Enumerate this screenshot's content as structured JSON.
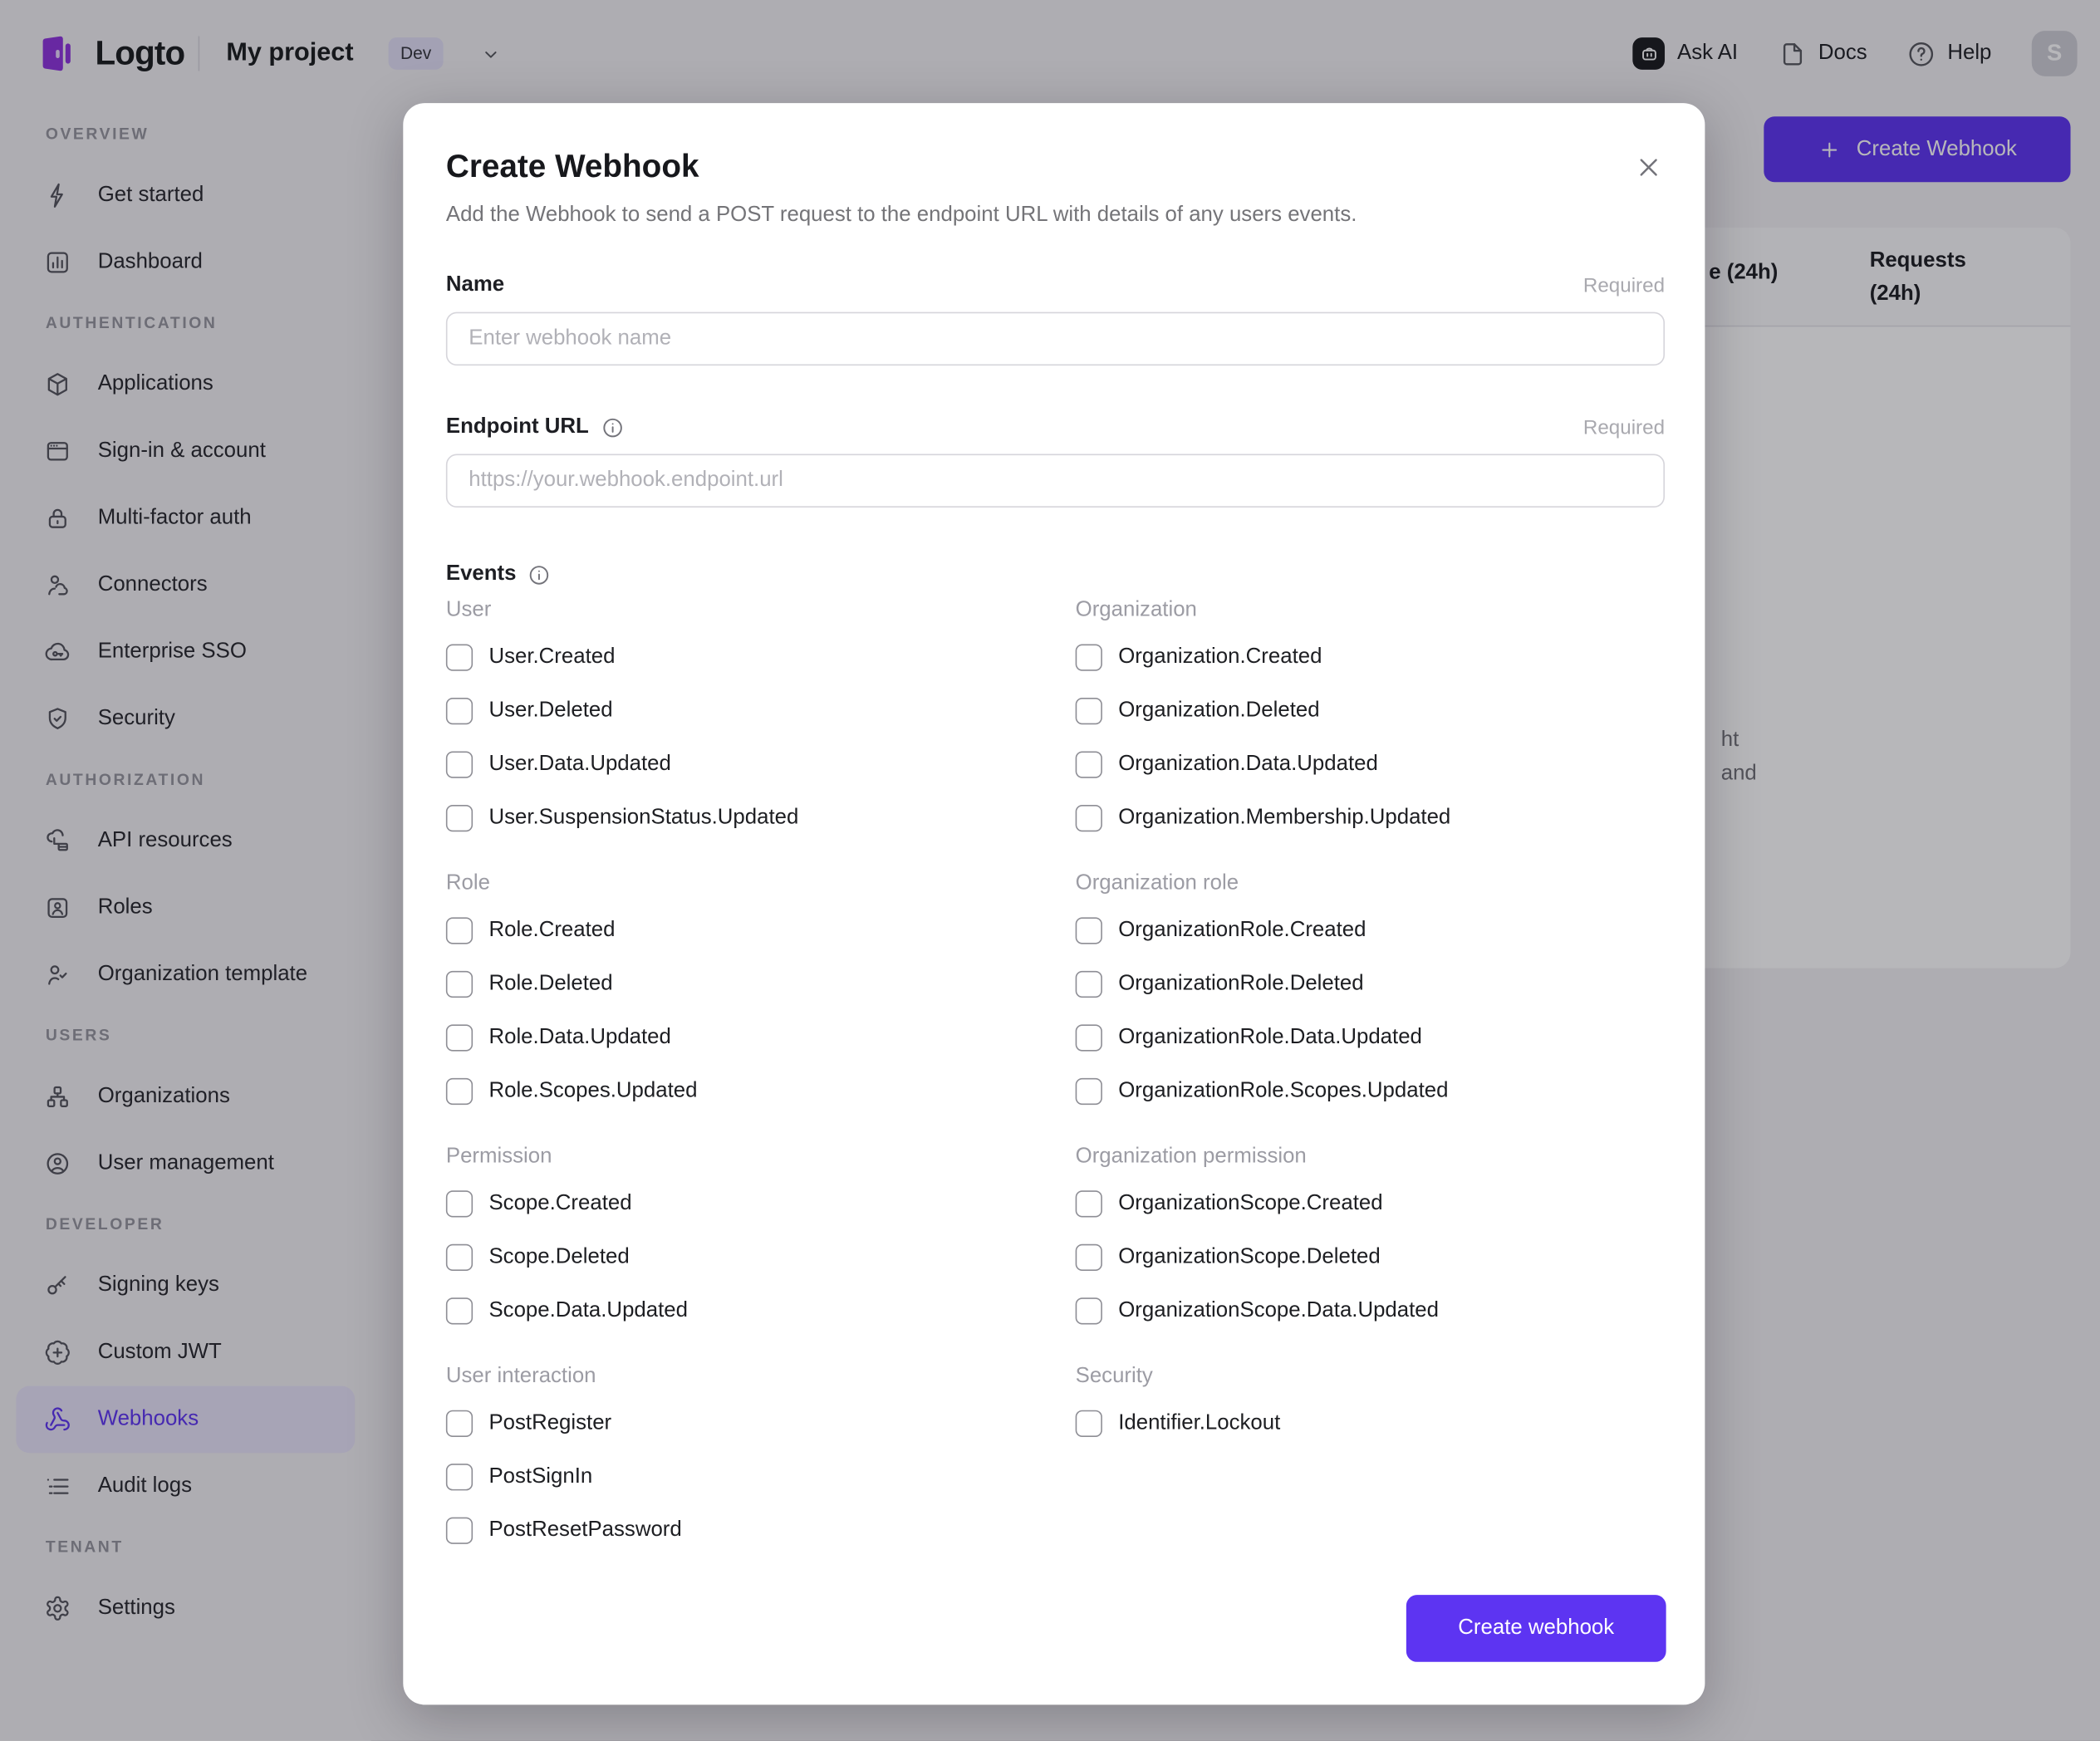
{
  "colors": {
    "primary": "#5d34f2",
    "active_nav_bg": "#e9e4fa",
    "env_badge_bg": "#e3e0f6"
  },
  "header": {
    "logo_text": "Logto",
    "project_name": "My project",
    "env_badge": "Dev",
    "ask_ai_label": "Ask AI",
    "docs_label": "Docs",
    "help_label": "Help",
    "avatar_initial": "S"
  },
  "sidebar": {
    "sections": [
      {
        "title": "OVERVIEW",
        "items": [
          {
            "label": "Get started"
          },
          {
            "label": "Dashboard"
          }
        ]
      },
      {
        "title": "AUTHENTICATION",
        "items": [
          {
            "label": "Applications"
          },
          {
            "label": "Sign-in & account"
          },
          {
            "label": "Multi-factor auth"
          },
          {
            "label": "Connectors"
          },
          {
            "label": "Enterprise SSO"
          },
          {
            "label": "Security"
          }
        ]
      },
      {
        "title": "AUTHORIZATION",
        "items": [
          {
            "label": "API resources"
          },
          {
            "label": "Roles"
          },
          {
            "label": "Organization template"
          }
        ]
      },
      {
        "title": "USERS",
        "items": [
          {
            "label": "Organizations"
          },
          {
            "label": "User management"
          }
        ]
      },
      {
        "title": "DEVELOPER",
        "items": [
          {
            "label": "Signing keys"
          },
          {
            "label": "Custom JWT"
          },
          {
            "label": "Webhooks"
          },
          {
            "label": "Audit logs"
          }
        ]
      },
      {
        "title": "TENANT",
        "items": [
          {
            "label": "Settings"
          }
        ]
      }
    ]
  },
  "background": {
    "create_webhook_button": "Create Webhook",
    "table_header_fragment": "e (24h)",
    "requests_header_line1": "Requests",
    "requests_header_line2": "(24h)",
    "empty_state_fragment_1": "ht",
    "empty_state_fragment_2": "and"
  },
  "modal": {
    "title": "Create Webhook",
    "description": "Add the Webhook to send a POST request to the endpoint URL with details of any users events.",
    "name_field": {
      "label": "Name",
      "required": "Required",
      "placeholder": "Enter webhook name",
      "value": ""
    },
    "endpoint_field": {
      "label": "Endpoint URL",
      "required": "Required",
      "placeholder": "https://your.webhook.endpoint.url",
      "value": ""
    },
    "events_label": "Events",
    "groups": [
      {
        "title": "User",
        "items": [
          "User.Created",
          "User.Deleted",
          "User.Data.Updated",
          "User.SuspensionStatus.Updated"
        ]
      },
      {
        "title": "Organization",
        "items": [
          "Organization.Created",
          "Organization.Deleted",
          "Organization.Data.Updated",
          "Organization.Membership.Updated"
        ]
      },
      {
        "title": "Role",
        "items": [
          "Role.Created",
          "Role.Deleted",
          "Role.Data.Updated",
          "Role.Scopes.Updated"
        ]
      },
      {
        "title": "Organization role",
        "items": [
          "OrganizationRole.Created",
          "OrganizationRole.Deleted",
          "OrganizationRole.Data.Updated",
          "OrganizationRole.Scopes.Updated"
        ]
      },
      {
        "title": "Permission",
        "items": [
          "Scope.Created",
          "Scope.Deleted",
          "Scope.Data.Updated"
        ]
      },
      {
        "title": "Organization permission",
        "items": [
          "OrganizationScope.Created",
          "OrganizationScope.Deleted",
          "OrganizationScope.Data.Updated"
        ]
      },
      {
        "title": "User interaction",
        "items": [
          "PostRegister",
          "PostSignIn",
          "PostResetPassword"
        ]
      },
      {
        "title": "Security",
        "items": [
          "Identifier.Lockout"
        ]
      }
    ],
    "submit_label": "Create webhook"
  }
}
